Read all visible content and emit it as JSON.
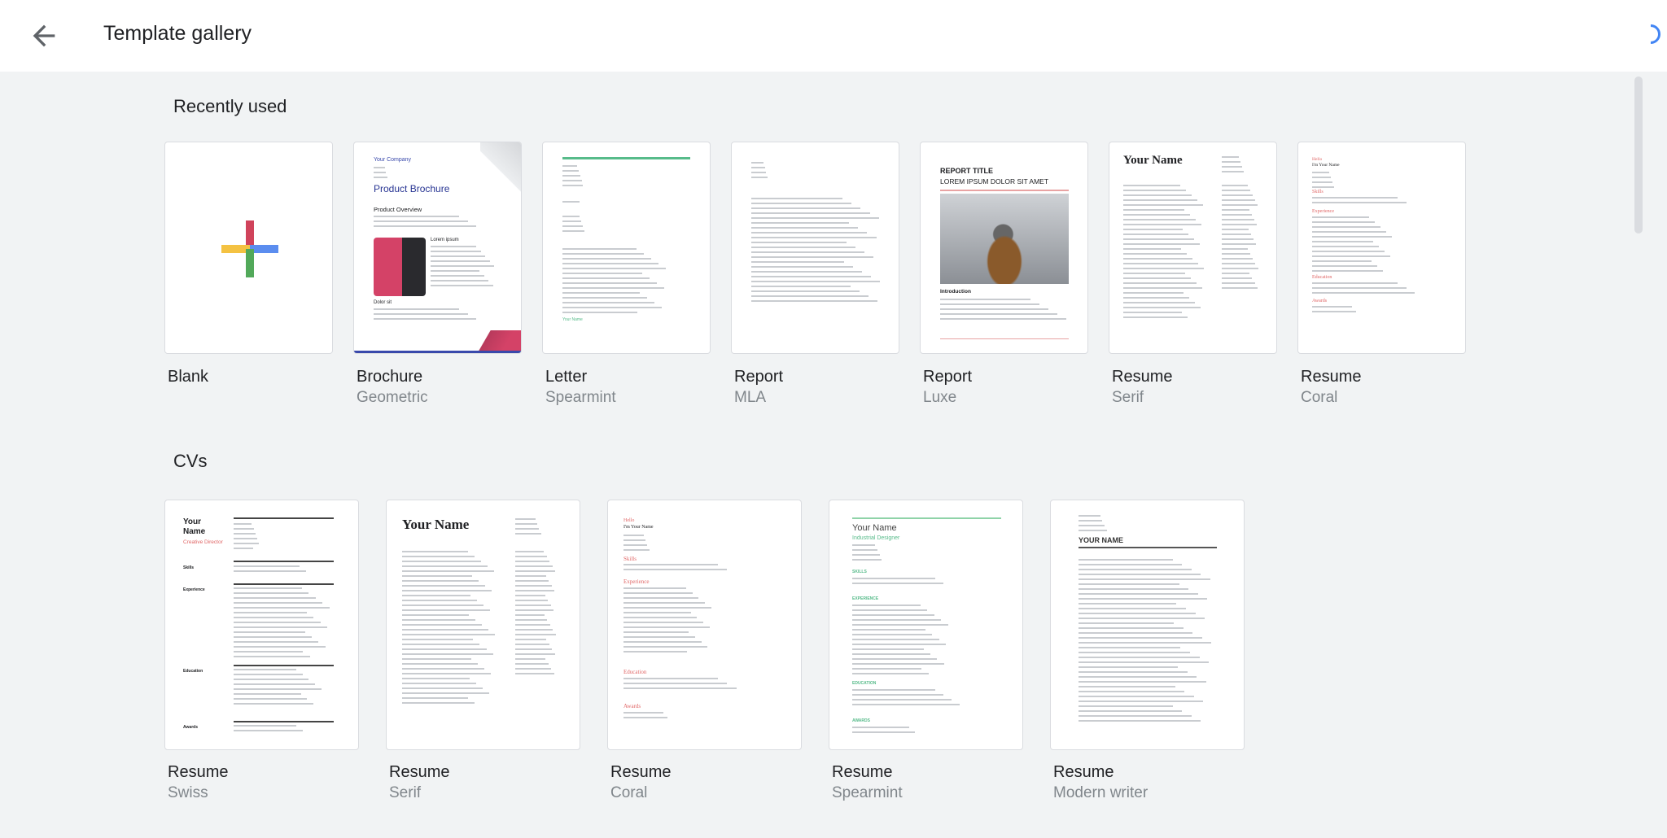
{
  "header": {
    "title": "Template gallery",
    "back_icon": "arrow-back-icon"
  },
  "sections": [
    {
      "title": "Recently used",
      "items": [
        {
          "name": "Blank",
          "sub": ""
        },
        {
          "name": "Brochure",
          "sub": "Geometric"
        },
        {
          "name": "Letter",
          "sub": "Spearmint"
        },
        {
          "name": "Report",
          "sub": "MLA"
        },
        {
          "name": "Report",
          "sub": "Luxe"
        },
        {
          "name": "Resume",
          "sub": "Serif"
        },
        {
          "name": "Resume",
          "sub": "Coral"
        }
      ]
    },
    {
      "title": "CVs",
      "items": [
        {
          "name": "Resume",
          "sub": "Swiss"
        },
        {
          "name": "Resume",
          "sub": "Serif"
        },
        {
          "name": "Resume",
          "sub": "Coral"
        },
        {
          "name": "Resume",
          "sub": "Spearmint"
        },
        {
          "name": "Resume",
          "sub": "Modern writer"
        }
      ]
    }
  ],
  "thumbs": {
    "brochure": {
      "company": "Your Company",
      "title": "Product Brochure",
      "overview": "Product Overview",
      "lorem": "Lorem ipsum",
      "dolor": "Dolor sit"
    },
    "letter": {
      "sign": "Your Name"
    },
    "luxe": {
      "title": "REPORT TITLE",
      "subtitle": "LOREM IPSUM DOLOR SIT AMET",
      "intro": "Introduction"
    },
    "serif": {
      "name": "Your Name"
    },
    "coral": {
      "hello": "Hello",
      "name": "I'm Your Name",
      "skills": "Skills",
      "experience": "Experience",
      "education": "Education",
      "awards": "Awards"
    },
    "swiss": {
      "name1": "Your",
      "name2": "Name",
      "role": "Creative Director",
      "skills": "Skills",
      "experience": "Experience",
      "education": "Education",
      "awards": "Awards"
    },
    "spearmint": {
      "name": "Your Name",
      "role": "Industrial Designer",
      "skills": "SKILLS",
      "experience": "EXPERIENCE",
      "education": "EDUCATION",
      "awards": "AWARDS"
    },
    "modern": {
      "name": "YOUR NAME"
    }
  },
  "colors": {
    "accent_blue": "#4285f4",
    "coral": "#e06666",
    "spearmint": "#57bb8a",
    "brochure_blue": "#3949ab"
  }
}
